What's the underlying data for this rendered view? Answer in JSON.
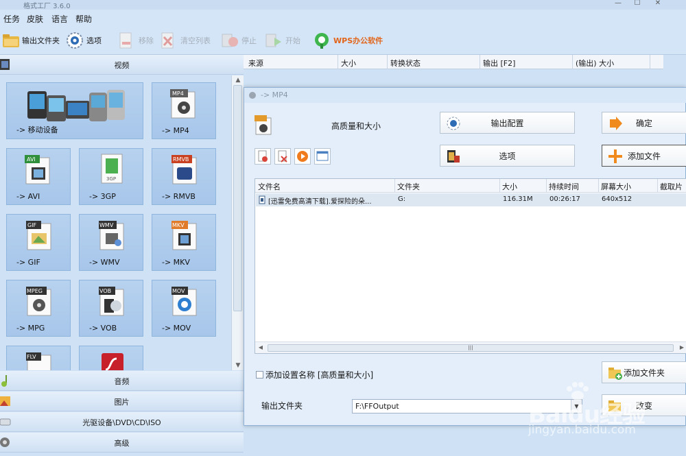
{
  "window": {
    "title": "格式工厂 3.6.0",
    "controls": [
      "—",
      "☐",
      "✕"
    ]
  },
  "menu": [
    "任务",
    "皮肤",
    "语言",
    "帮助"
  ],
  "toolbar": {
    "output_folder": "输出文件夹",
    "options": "选项",
    "remove": "移除",
    "clear_list": "清空列表",
    "stop": "停止",
    "start": "开始",
    "wps": "WPS办公软件"
  },
  "categories": {
    "video": "视频",
    "audio": "音频",
    "picture": "图片",
    "rom": "光驱设备\\DVD\\CD\\ISO",
    "advanced": "高级"
  },
  "tiles": [
    {
      "label": "-> 移动设备",
      "badge": ""
    },
    {
      "label": "-> MP4",
      "badge": "MP4"
    },
    {
      "label": "-> AVI",
      "badge": "AVI"
    },
    {
      "label": "-> 3GP",
      "badge": "3GP"
    },
    {
      "label": "-> RMVB",
      "badge": "RMVB"
    },
    {
      "label": "-> GIF",
      "badge": "GIF"
    },
    {
      "label": "-> WMV",
      "badge": "WMV"
    },
    {
      "label": "-> MKV",
      "badge": "MKV"
    },
    {
      "label": "-> MPG",
      "badge": "MPEG"
    },
    {
      "label": "-> VOB",
      "badge": "VOB"
    },
    {
      "label": "-> MOV",
      "badge": "MOV"
    },
    {
      "label": "",
      "badge": "FLV"
    },
    {
      "label": "",
      "badge": ""
    }
  ],
  "list_header": [
    "来源",
    "大小",
    "转换状态",
    "输出 [F2]",
    "(输出) 大小"
  ],
  "dialog": {
    "title": "-> MP4",
    "profile": "高质量和大小",
    "output_config": "输出配置",
    "ok": "确定",
    "options": "选项",
    "add_file": "添加文件",
    "table_headers": [
      "文件名",
      "文件夹",
      "大小",
      "持续时间",
      "屏幕大小",
      "截取片段"
    ],
    "row": {
      "name": "[迅雷免费高清下载].爱探险的朵...",
      "folder": "G:",
      "size": "116.31M",
      "duration": "00:26:17",
      "screen": "640x512",
      "clip": ""
    },
    "scroll_grip": "|||",
    "add_setting_name": "添加设置名称 [高质量和大小]",
    "add_folder": "添加文件夹",
    "output_folder_label": "输出文件夹",
    "output_folder_value": "F:\\FFOutput",
    "change": "改变"
  },
  "watermark": {
    "logo": "Baidu经验",
    "url": "jingyan.baidu.com"
  },
  "colors": {
    "tile_bg": "#a9c8ec",
    "panel_bg": "#cfe2f5",
    "accent_orange": "#f08a1c"
  }
}
